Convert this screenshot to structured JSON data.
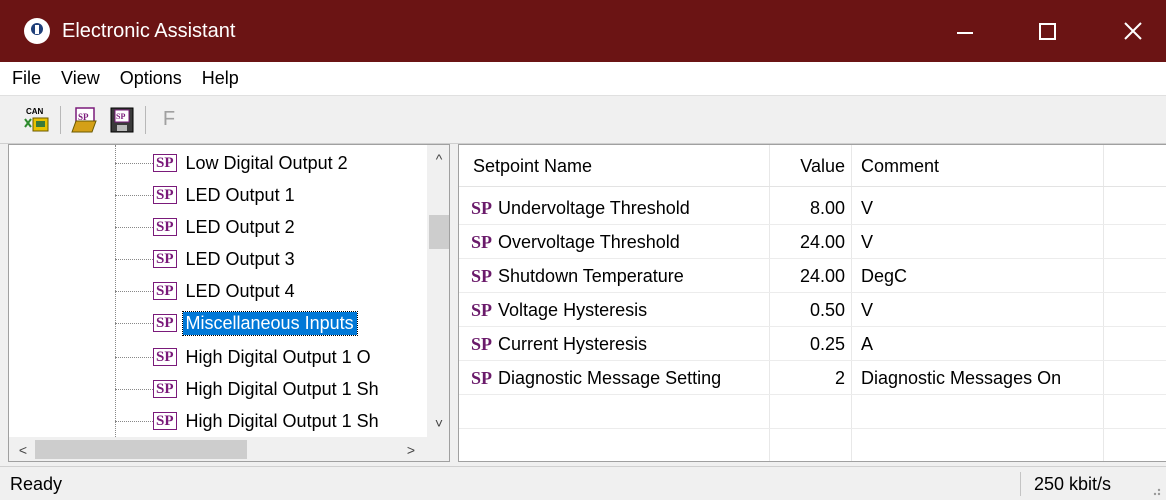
{
  "window": {
    "title": "Electronic Assistant"
  },
  "menu": [
    "File",
    "View",
    "Options",
    "Help"
  ],
  "toolbar": {
    "can_icon_text": "CAN",
    "sp_icon_text": "SP",
    "f_label": "F"
  },
  "tree": {
    "badge": "SP",
    "items": [
      "Low Digital Output 2",
      "LED Output 1",
      "LED Output 2",
      "LED Output 3",
      "LED Output 4",
      "Miscellaneous Inputs",
      "High Digital Output 1 O",
      "High Digital Output 1 Sh",
      "High Digital Output 1 Sh"
    ],
    "selected_index": 5,
    "scroll_up": "^",
    "scroll_down": "˅",
    "scroll_left": "<",
    "scroll_right": ">"
  },
  "table": {
    "columns": [
      "Setpoint Name",
      "Value",
      "Comment"
    ],
    "badge": "SP",
    "rows": [
      {
        "name": "Undervoltage Threshold",
        "value": "8.00",
        "comment": "V"
      },
      {
        "name": "Overvoltage Threshold",
        "value": "24.00",
        "comment": "V"
      },
      {
        "name": "Shutdown Temperature",
        "value": "24.00",
        "comment": "DegC"
      },
      {
        "name": "Voltage Hysteresis",
        "value": "0.50",
        "comment": "V"
      },
      {
        "name": "Current Hysteresis",
        "value": "0.25",
        "comment": "A"
      },
      {
        "name": "Diagnostic Message Setting",
        "value": "2",
        "comment": "Diagnostic Messages On"
      }
    ]
  },
  "status": {
    "left": "Ready",
    "right": "250 kbit/s"
  },
  "colors": {
    "titlebar": "#6b1414",
    "sp_badge": "#7a1a7a",
    "selection": "#0078d7"
  }
}
